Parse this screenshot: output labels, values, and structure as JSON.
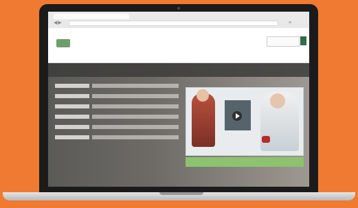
{
  "colors": {
    "background": "#f07a32",
    "accent_green": "#8dc26e",
    "header_button": "#356a4a"
  },
  "browser": {
    "tab_label": "",
    "address": "",
    "back_icon": "back-arrow-icon",
    "forward_icon": "forward-arrow-icon",
    "menu_icon": "menu-icon"
  },
  "site": {
    "logo_text": "",
    "nav": [
      "",
      "",
      "",
      ""
    ],
    "subline": ""
  },
  "hero": {
    "title": "",
    "rows": [
      {
        "label": "",
        "value": ""
      },
      {
        "label": "",
        "value": ""
      },
      {
        "label": "",
        "value": ""
      },
      {
        "label": "",
        "value": ""
      },
      {
        "label": "",
        "value": ""
      },
      {
        "label": "",
        "value": ""
      }
    ],
    "feature_caption": ""
  }
}
